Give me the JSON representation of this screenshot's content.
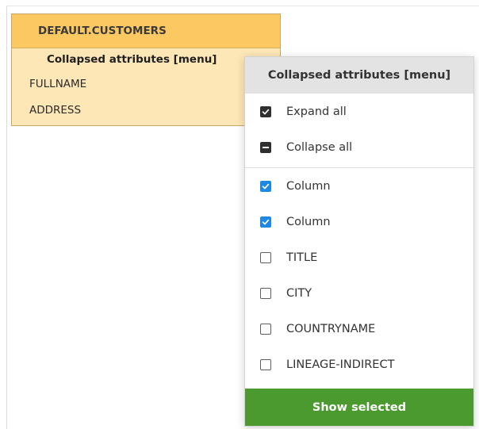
{
  "entity": {
    "title": "DEFAULT.CUSTOMERS",
    "subheader": "Collapsed attributes [menu]",
    "rows": [
      "FULLNAME",
      "ADDRESS"
    ]
  },
  "menu": {
    "title": "Collapsed attributes [menu]",
    "actions": [
      {
        "label": "Expand all",
        "icon": "checked-square-icon"
      },
      {
        "label": "Collapse all",
        "icon": "minus-square-icon"
      }
    ],
    "options": [
      {
        "label": "Column",
        "checked": true
      },
      {
        "label": "Column",
        "checked": true
      },
      {
        "label": "TITLE",
        "checked": false
      },
      {
        "label": "CITY",
        "checked": false
      },
      {
        "label": "COUNTRYNAME",
        "checked": false
      },
      {
        "label": "LINEAGE-INDIRECT",
        "checked": false
      }
    ],
    "show_selected_label": "Show selected"
  },
  "colors": {
    "entity_header": "#fbc862",
    "entity_body": "#fde7b7",
    "checkbox_checked": "#1e88e5",
    "show_selected_bg": "#4a9a2f"
  }
}
